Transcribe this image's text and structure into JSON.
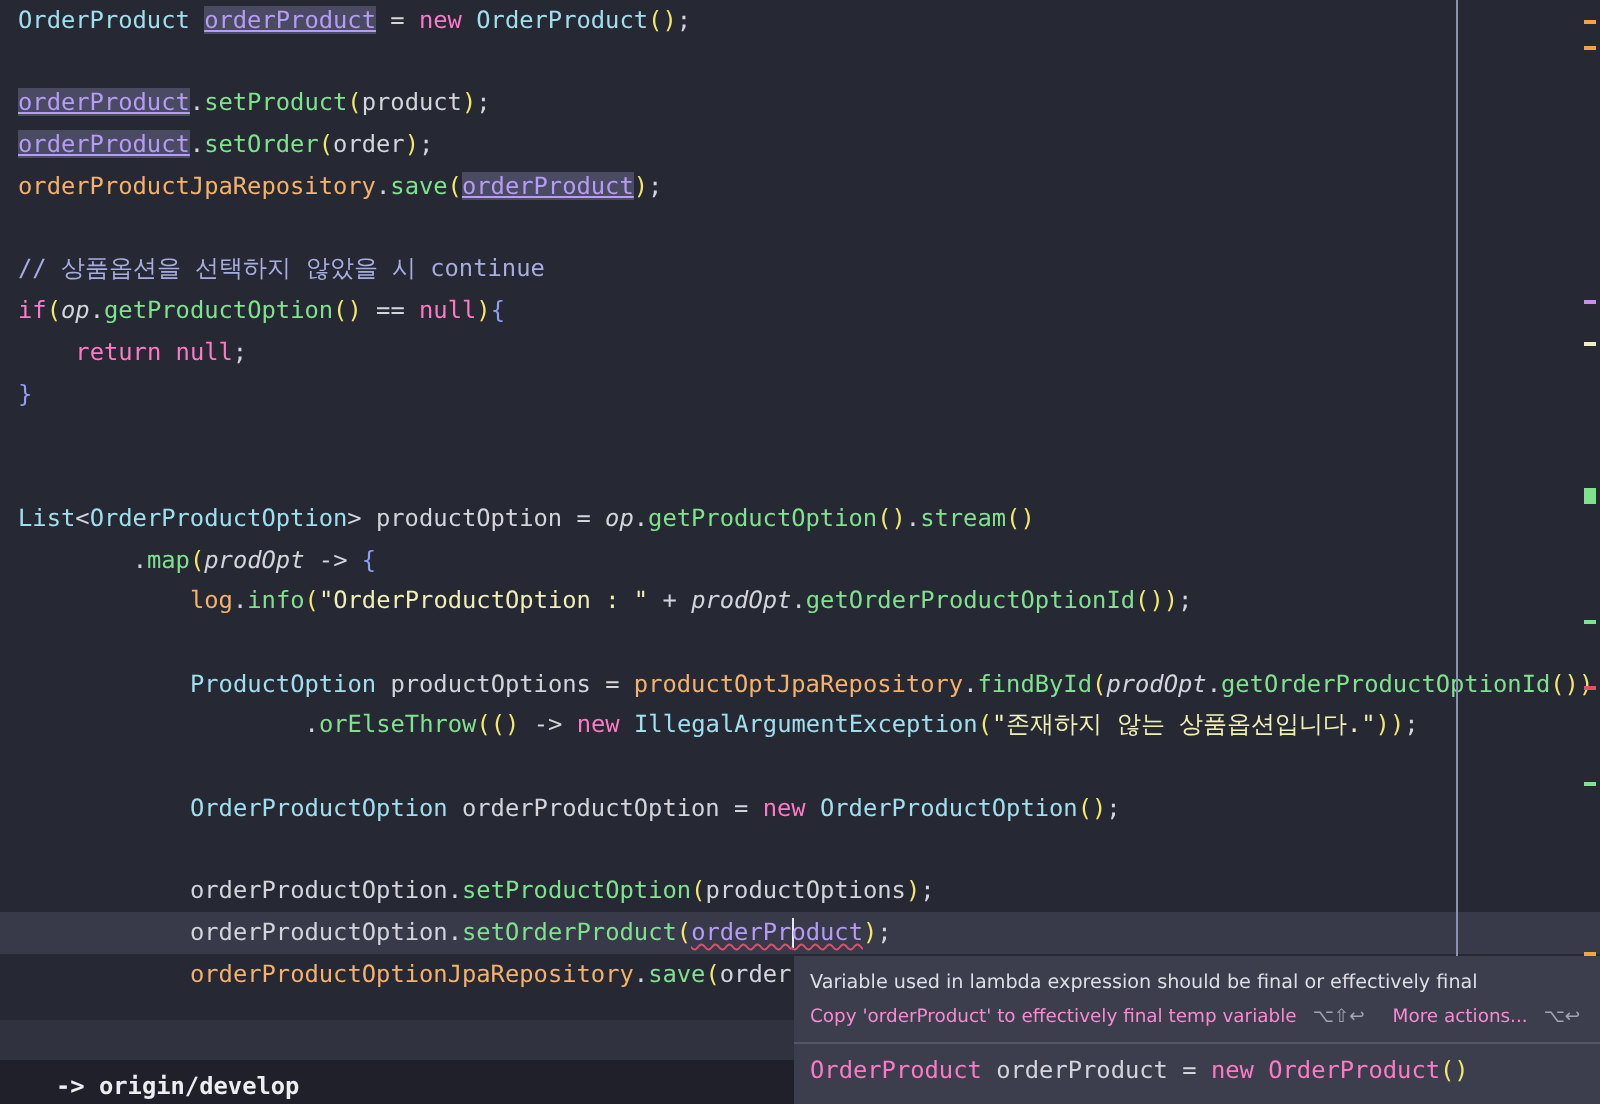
{
  "editor": {
    "lines": [
      {
        "kind": "statement",
        "current": false,
        "tokens": [
          {
            "kind": "type",
            "text": "OrderProduct"
          },
          {
            "kind": "space"
          },
          {
            "kind": "usage",
            "text": "orderProduct"
          },
          {
            "kind": "plain",
            "text": " = "
          },
          {
            "kind": "keyword",
            "text": "new"
          },
          {
            "kind": "space"
          },
          {
            "kind": "type",
            "text": "OrderProduct"
          },
          {
            "kind": "paren",
            "text": "()"
          },
          {
            "kind": "plain",
            "text": ";"
          }
        ]
      },
      {
        "kind": "blank",
        "current": false
      },
      {
        "kind": "statement",
        "current": false,
        "tokens": [
          {
            "kind": "usage",
            "text": "orderProduct"
          },
          {
            "kind": "plain",
            "text": "."
          },
          {
            "kind": "method",
            "text": "setProduct"
          },
          {
            "kind": "paren",
            "text": "("
          },
          {
            "kind": "plain",
            "text": "product"
          },
          {
            "kind": "paren",
            "text": ")"
          },
          {
            "kind": "plain",
            "text": ";"
          }
        ]
      },
      {
        "kind": "statement",
        "current": false,
        "tokens": [
          {
            "kind": "usage",
            "text": "orderProduct"
          },
          {
            "kind": "plain",
            "text": "."
          },
          {
            "kind": "method",
            "text": "setOrder"
          },
          {
            "kind": "paren",
            "text": "("
          },
          {
            "kind": "plain",
            "text": "order"
          },
          {
            "kind": "paren",
            "text": ")"
          },
          {
            "kind": "plain",
            "text": ";"
          }
        ]
      },
      {
        "kind": "statement",
        "current": false,
        "tokens": [
          {
            "kind": "field",
            "text": "orderProductJpaRepository"
          },
          {
            "kind": "plain",
            "text": "."
          },
          {
            "kind": "method",
            "text": "save"
          },
          {
            "kind": "paren",
            "text": "("
          },
          {
            "kind": "usage",
            "text": "orderProduct"
          },
          {
            "kind": "paren",
            "text": ")"
          },
          {
            "kind": "plain",
            "text": ";"
          }
        ]
      },
      {
        "kind": "blank",
        "current": false
      },
      {
        "kind": "statement",
        "current": false,
        "tokens": [
          {
            "kind": "comment",
            "text": "// 상품옵션을 선택하지 않았을 시 continue"
          }
        ]
      },
      {
        "kind": "statement",
        "current": false,
        "tokens": [
          {
            "kind": "keyword",
            "text": "if"
          },
          {
            "kind": "paren",
            "text": "("
          },
          {
            "kind": "italic",
            "text": "op"
          },
          {
            "kind": "plain",
            "text": "."
          },
          {
            "kind": "method",
            "text": "getProductOption"
          },
          {
            "kind": "paren",
            "text": "()"
          },
          {
            "kind": "plain",
            "text": " == "
          },
          {
            "kind": "keyword",
            "text": "null"
          },
          {
            "kind": "paren",
            "text": ")"
          },
          {
            "kind": "brace",
            "text": "{"
          }
        ],
        "children": [
          {
            "kind": "statement",
            "current": false,
            "tokens": [
              {
                "kind": "keyword",
                "text": "return"
              },
              {
                "kind": "space"
              },
              {
                "kind": "keyword",
                "text": "null"
              },
              {
                "kind": "plain",
                "text": ";"
              }
            ]
          }
        ]
      },
      {
        "kind": "statement",
        "current": false,
        "tokens": [
          {
            "kind": "brace",
            "text": "}"
          }
        ]
      },
      {
        "kind": "blank",
        "current": false
      },
      {
        "kind": "blank",
        "current": false
      },
      {
        "kind": "statement",
        "current": false,
        "tokens": [
          {
            "kind": "type",
            "text": "List"
          },
          {
            "kind": "plain",
            "text": "<"
          },
          {
            "kind": "type",
            "text": "OrderProductOption"
          },
          {
            "kind": "plain",
            "text": "> productOption = "
          },
          {
            "kind": "italic",
            "text": "op"
          },
          {
            "kind": "plain",
            "text": "."
          },
          {
            "kind": "method",
            "text": "getProductOption"
          },
          {
            "kind": "paren",
            "text": "()"
          },
          {
            "kind": "plain",
            "text": "."
          },
          {
            "kind": "method",
            "text": "stream"
          },
          {
            "kind": "paren",
            "text": "()"
          }
        ],
        "children": [
          {
            "kind": "continuation",
            "current": false,
            "tokens": [
              {
                "kind": "plain",
                "text": "."
              },
              {
                "kind": "method",
                "text": "map"
              },
              {
                "kind": "paren",
                "text": "("
              },
              {
                "kind": "italic",
                "text": "prodOpt"
              },
              {
                "kind": "plain",
                "text": " -> "
              },
              {
                "kind": "brace",
                "text": "{"
              }
            ],
            "children": [
              {
                "kind": "statement",
                "current": false,
                "tokens": [
                  {
                    "kind": "field",
                    "text": "log"
                  },
                  {
                    "kind": "plain",
                    "text": "."
                  },
                  {
                    "kind": "method",
                    "text": "info"
                  },
                  {
                    "kind": "paren",
                    "text": "("
                  },
                  {
                    "kind": "string",
                    "text": "\"OrderProductOption : \""
                  },
                  {
                    "kind": "plain",
                    "text": " + "
                  },
                  {
                    "kind": "italic",
                    "text": "prodOpt"
                  },
                  {
                    "kind": "plain",
                    "text": "."
                  },
                  {
                    "kind": "method",
                    "text": "getOrderProductOptionId"
                  },
                  {
                    "kind": "paren",
                    "text": "())"
                  },
                  {
                    "kind": "plain",
                    "text": ";"
                  }
                ]
              },
              {
                "kind": "blank",
                "current": false
              },
              {
                "kind": "statement",
                "current": false,
                "tokens": [
                  {
                    "kind": "type",
                    "text": "ProductOption"
                  },
                  {
                    "kind": "plain",
                    "text": " productOptions = "
                  },
                  {
                    "kind": "field",
                    "text": "productOptJpaRepository"
                  },
                  {
                    "kind": "plain",
                    "text": "."
                  },
                  {
                    "kind": "method",
                    "text": "findById"
                  },
                  {
                    "kind": "paren",
                    "text": "("
                  },
                  {
                    "kind": "italic",
                    "text": "prodOpt"
                  },
                  {
                    "kind": "plain",
                    "text": "."
                  },
                  {
                    "kind": "method",
                    "text": "getOrderProductOptionId"
                  },
                  {
                    "kind": "paren",
                    "text": "())"
                  }
                ],
                "children": [
                  {
                    "kind": "continuation",
                    "current": false,
                    "tokens": [
                      {
                        "kind": "plain",
                        "text": "."
                      },
                      {
                        "kind": "method",
                        "text": "orElseThrow"
                      },
                      {
                        "kind": "paren",
                        "text": "(()"
                      },
                      {
                        "kind": "plain",
                        "text": " -> "
                      },
                      {
                        "kind": "keyword",
                        "text": "new"
                      },
                      {
                        "kind": "space"
                      },
                      {
                        "kind": "type",
                        "text": "IllegalArgumentException"
                      },
                      {
                        "kind": "paren",
                        "text": "("
                      },
                      {
                        "kind": "string",
                        "text": "\"존재하지 않는 상품옵션입니다.\""
                      },
                      {
                        "kind": "paren",
                        "text": "))"
                      },
                      {
                        "kind": "plain",
                        "text": ";"
                      }
                    ]
                  }
                ]
              },
              {
                "kind": "blank",
                "current": false
              },
              {
                "kind": "statement",
                "current": false,
                "tokens": [
                  {
                    "kind": "type",
                    "text": "OrderProductOption"
                  },
                  {
                    "kind": "plain",
                    "text": " orderProductOption = "
                  },
                  {
                    "kind": "keyword",
                    "text": "new"
                  },
                  {
                    "kind": "space"
                  },
                  {
                    "kind": "type",
                    "text": "OrderProductOption"
                  },
                  {
                    "kind": "paren",
                    "text": "()"
                  },
                  {
                    "kind": "plain",
                    "text": ";"
                  }
                ]
              },
              {
                "kind": "blank",
                "current": false
              },
              {
                "kind": "statement",
                "current": false,
                "tokens": [
                  {
                    "kind": "plain",
                    "text": "orderProductOption."
                  },
                  {
                    "kind": "method",
                    "text": "setProductOption"
                  },
                  {
                    "kind": "paren",
                    "text": "("
                  },
                  {
                    "kind": "plain",
                    "text": "productOptions"
                  },
                  {
                    "kind": "paren",
                    "text": ")"
                  },
                  {
                    "kind": "plain",
                    "text": ";"
                  }
                ]
              },
              {
                "kind": "statement",
                "current": true,
                "tokens": [
                  {
                    "kind": "plain",
                    "text": "orderProductOption."
                  },
                  {
                    "kind": "method",
                    "text": "setOrderProduct"
                  },
                  {
                    "kind": "paren",
                    "text": "("
                  },
                  {
                    "kind": "error",
                    "text": "orderPr",
                    "caret": true
                  },
                  {
                    "kind": "error",
                    "text": "oduct"
                  },
                  {
                    "kind": "paren",
                    "text": ")"
                  },
                  {
                    "kind": "plain",
                    "text": ";"
                  }
                ]
              },
              {
                "kind": "statement",
                "current": false,
                "tokens": [
                  {
                    "kind": "field",
                    "text": "orderProductOptionJpaRepository"
                  },
                  {
                    "kind": "plain",
                    "text": "."
                  },
                  {
                    "kind": "method",
                    "text": "save"
                  },
                  {
                    "kind": "paren",
                    "text": "("
                  },
                  {
                    "kind": "plain",
                    "text": "order"
                  }
                ]
              }
            ]
          }
        ]
      }
    ]
  },
  "popup": {
    "message": "Variable used in lambda expression should be final or effectively final",
    "actions": [
      {
        "label": "Copy 'orderProduct' to effectively final temp variable",
        "shortcut": "⌥⇧↩"
      },
      {
        "label": "More actions...",
        "shortcut": "⌥↩"
      }
    ],
    "preview": [
      {
        "kind": "keyword",
        "text": "OrderProduct"
      },
      {
        "kind": "plain",
        "text": " orderProduct = "
      },
      {
        "kind": "keyword",
        "text": "new"
      },
      {
        "kind": "space"
      },
      {
        "kind": "keyword",
        "text": "OrderProduct"
      },
      {
        "kind": "paren",
        "text": "()"
      }
    ]
  },
  "git_pane": {
    "text": "-> origin/develop"
  }
}
